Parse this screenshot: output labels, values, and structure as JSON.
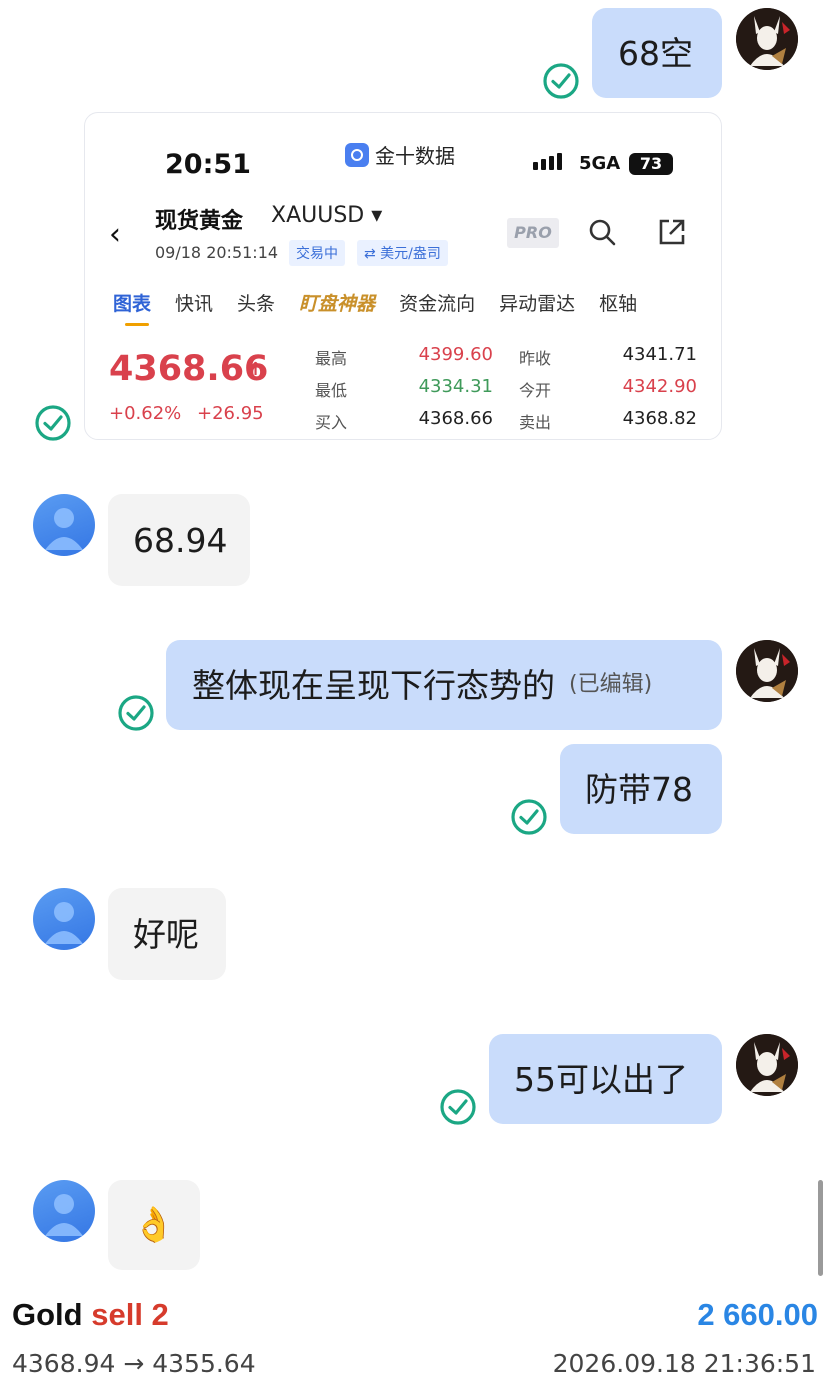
{
  "chat": {
    "messages": [
      {
        "text": "68空"
      },
      {
        "text": "68.94"
      },
      {
        "text": "整体现在呈现下行态势的",
        "edited": "(已编辑)"
      },
      {
        "text": "防带78"
      },
      {
        "text": "好呢"
      },
      {
        "text": "55可以出了"
      },
      {
        "text": "👌"
      }
    ]
  },
  "card": {
    "time": "20:51",
    "app_name": "金十数据",
    "network": "5GA",
    "battery": "73",
    "title": "现货黄金",
    "symbol": "XAUUSD ▾",
    "date": "09/18 20:51:14",
    "status_tag": "交易中",
    "currency_tag": "⇄ 美元/盎司",
    "pro": "PRO",
    "tabs": [
      "图表",
      "快讯",
      "头条",
      "盯盘神器",
      "资金流向",
      "异动雷达",
      "枢轴"
    ],
    "price": "4368.66",
    "price_arrow": "↑",
    "change_pct": "+0.62%",
    "change_abs": "+26.95",
    "quotes": [
      {
        "label": "最高",
        "value": "4399.60",
        "label2": "昨收",
        "value2": "4341.71"
      },
      {
        "label": "最低",
        "value": "4334.31",
        "label2": "今开",
        "value2": "4342.90"
      },
      {
        "label": "买入",
        "value": "4368.66",
        "label2": "卖出",
        "value2": "4368.82"
      }
    ],
    "colors": {
      "up": "#d9414c",
      "down": "#3f9a5a"
    }
  },
  "footer": {
    "instrument": "Gold",
    "action": "sell 2",
    "amount": "2 660.00",
    "prices": "4368.94 → 4355.64",
    "datetime": "2026.09.18 21:36:51"
  }
}
